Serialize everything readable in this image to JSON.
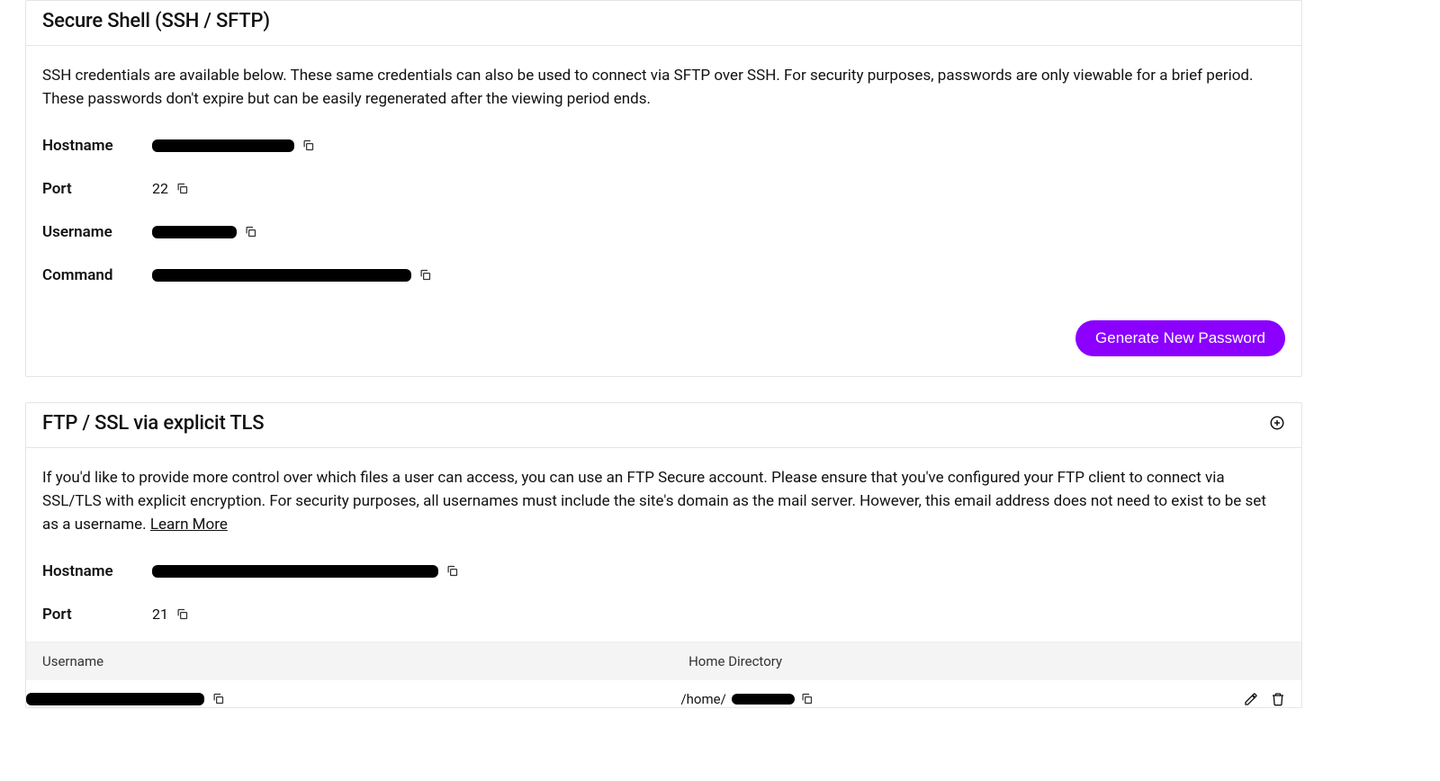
{
  "ssh": {
    "title": "Secure Shell (SSH / SFTP)",
    "desc": "SSH credentials are available below. These same credentials can also be used to connect via SFTP over SSH. For security purposes, passwords are only viewable for a brief period. These passwords don't expire but can be easily regenerated after the viewing period ends.",
    "labels": {
      "hostname": "Hostname",
      "port": "Port",
      "username": "Username",
      "command": "Command"
    },
    "values": {
      "port": "22"
    },
    "generate_btn": "Generate New Password"
  },
  "ftp": {
    "title": "FTP / SSL via explicit TLS",
    "desc_prefix": "If you'd like to provide more control over which files a user can access, you can use an FTP Secure account. Please ensure that you've configured your FTP client to connect via SSL/TLS with explicit encryption. For security purposes, all usernames must include the site's domain as the mail server. However, this email address does not need to exist to be set as a username. ",
    "learn_more": "Learn More",
    "labels": {
      "hostname": "Hostname",
      "port": "Port"
    },
    "values": {
      "port": "21"
    },
    "table": {
      "col_username": "Username",
      "col_home": "Home Directory",
      "row_home_prefix": "/home/"
    }
  }
}
